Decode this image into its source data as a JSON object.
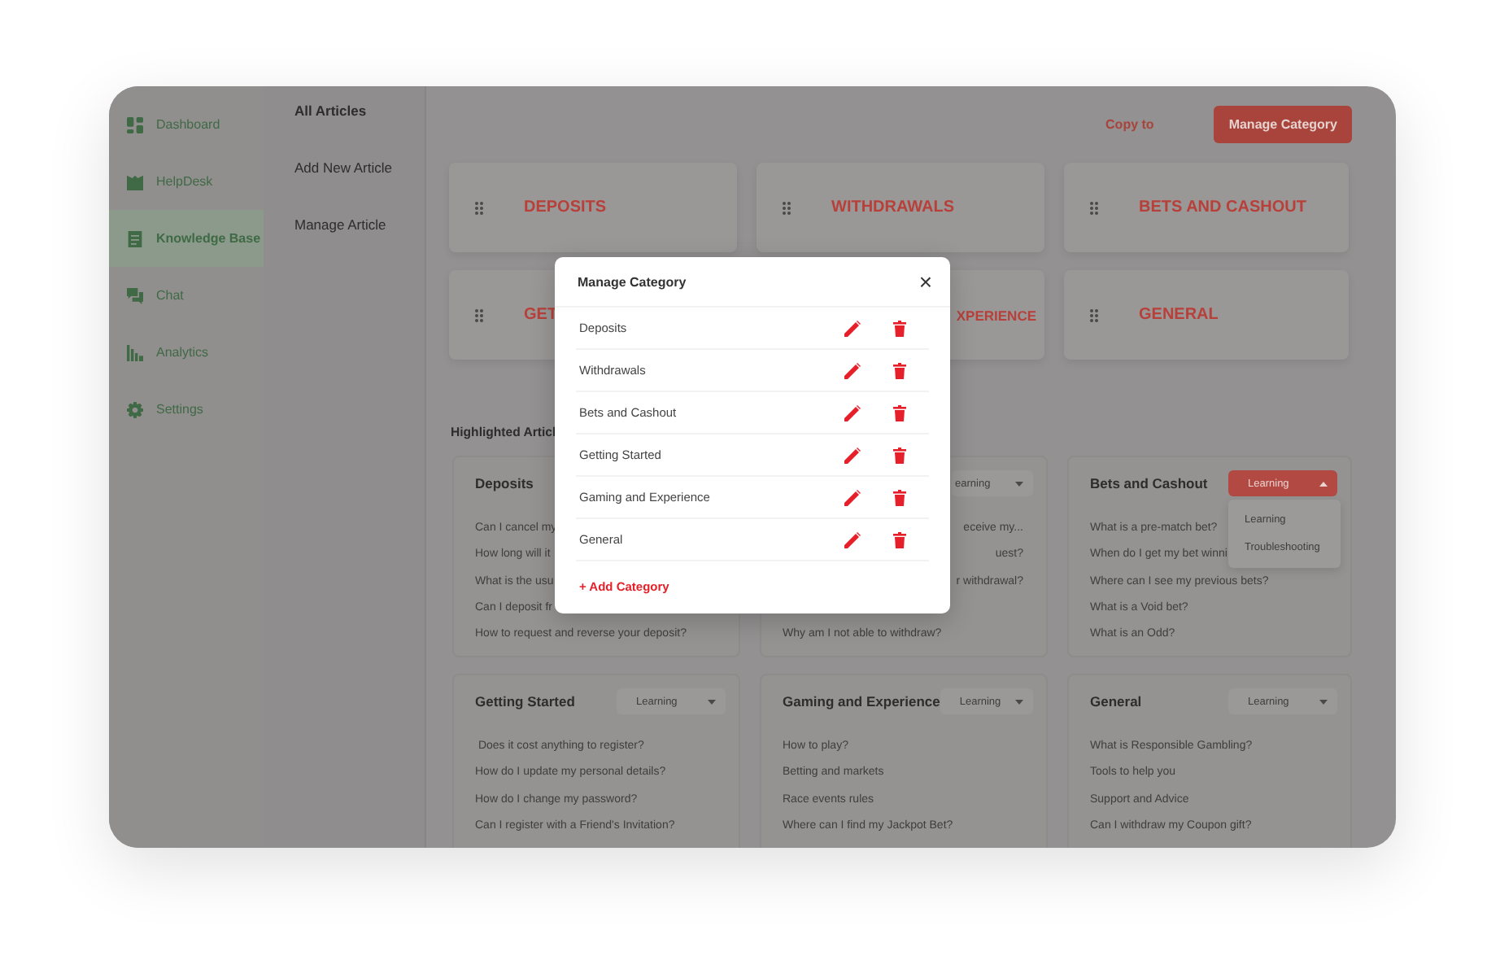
{
  "sidebar": {
    "items": [
      {
        "label": "Dashboard",
        "selected": false
      },
      {
        "label": "HelpDesk",
        "selected": false
      },
      {
        "label": "Knowledge Base",
        "selected": true
      },
      {
        "label": "Chat",
        "selected": false
      },
      {
        "label": "Analytics",
        "selected": false
      },
      {
        "label": "Settings",
        "selected": false
      }
    ]
  },
  "subnav": {
    "items": [
      {
        "label": "All Articles",
        "selected": true
      },
      {
        "label": "Add New Article",
        "selected": false
      },
      {
        "label": "Manage Article",
        "selected": false
      }
    ]
  },
  "toolbar": {
    "link": "Copy to",
    "button": "Manage Category"
  },
  "categories": [
    {
      "label": "DEPOSITS",
      "cut_start": false
    },
    {
      "label": "WITHDRAWALS",
      "cut_start": false
    },
    {
      "label": "BETS AND CASHOUT",
      "cut_start": false
    },
    {
      "label": "GET",
      "cut_start": false
    },
    {
      "label": "XPERIENCE",
      "cut_start": true
    },
    {
      "label": "GENERAL",
      "cut_start": false
    }
  ],
  "highlighted": {
    "title": "Highlighted Articl",
    "cards": [
      {
        "title": "Deposits",
        "items": [
          {
            "text": "Can I cancel my",
            "cut_start": false,
            "after_gap": false
          },
          {
            "text": "How long will it",
            "cut_start": false,
            "after_gap": false
          },
          {
            "text": "What is the usu",
            "cut_start": false,
            "after_gap": false
          },
          {
            "text": "Can I deposit fr",
            "cut_start": false,
            "after_gap": false
          },
          {
            "text": "How to request and reverse your deposit?",
            "cut_start": false,
            "after_gap": false
          }
        ]
      },
      {
        "dropdown": {
          "value": "earning",
          "cut_start": true,
          "expanded": false
        },
        "items": [
          {
            "text": "eceive my...",
            "cut_start": true,
            "after_gap": false
          },
          {
            "text": "uest?",
            "cut_start": true,
            "after_gap": false
          },
          {
            "text": "r withdrawal?",
            "cut_start": true,
            "after_gap": false
          },
          {
            "text": "Why am I not able to withdraw?",
            "cut_start": false,
            "after_gap": true
          }
        ]
      },
      {
        "title": "Bets and Cashout",
        "dropdown": {
          "value": "Learning",
          "cut_start": false,
          "expanded": true,
          "options": [
            "Learning",
            "Troubleshooting"
          ]
        },
        "items": [
          {
            "text": "What is a pre-match bet?",
            "cut_start": false,
            "after_gap": false
          },
          {
            "text": "When do I get my bet winni",
            "cut_start": false,
            "after_gap": false
          },
          {
            "text": "Where can I see my previous bets?",
            "cut_start": false,
            "after_gap": false
          },
          {
            "text": "What is a Void bet?",
            "cut_start": false,
            "after_gap": false
          },
          {
            "text": "What is an Odd?",
            "cut_start": false,
            "after_gap": false
          }
        ]
      },
      {
        "title": "Getting Started",
        "dropdown": {
          "value": "Learning",
          "cut_start": false,
          "expanded": false
        },
        "items": [
          {
            "text": " Does it cost anything to register?",
            "cut_start": false,
            "after_gap": false
          },
          {
            "text": "How do I update my personal details?",
            "cut_start": false,
            "after_gap": false
          },
          {
            "text": "How do I change my password?",
            "cut_start": false,
            "after_gap": false
          },
          {
            "text": "Can I register with a Friend's Invitation?",
            "cut_start": false,
            "after_gap": false
          }
        ]
      },
      {
        "title": "Gaming and Experience",
        "dropdown": {
          "value": "Learning",
          "cut_start": false,
          "expanded": false
        },
        "items": [
          {
            "text": "How to play?",
            "cut_start": false,
            "after_gap": false
          },
          {
            "text": "Betting and markets",
            "cut_start": false,
            "after_gap": false
          },
          {
            "text": "Race events rules",
            "cut_start": false,
            "after_gap": false
          },
          {
            "text": "Where can I find my Jackpot Bet?",
            "cut_start": false,
            "after_gap": false
          }
        ]
      },
      {
        "title": "General",
        "dropdown": {
          "value": "Learning",
          "cut_start": false,
          "expanded": false
        },
        "items": [
          {
            "text": "What is Responsible Gambling?",
            "cut_start": false,
            "after_gap": false
          },
          {
            "text": "Tools to help you",
            "cut_start": false,
            "after_gap": false
          },
          {
            "text": "Support and Advice",
            "cut_start": false,
            "after_gap": false
          },
          {
            "text": "Can I withdraw my Coupon gift?",
            "cut_start": false,
            "after_gap": false
          }
        ]
      }
    ]
  },
  "modal": {
    "title": "Manage Category",
    "close": "×",
    "rows": [
      "Deposits",
      "Withdrawals",
      "Bets and Cashout",
      "Getting Started",
      "Gaming and Experience",
      "General"
    ],
    "add": "+ Add Category"
  }
}
